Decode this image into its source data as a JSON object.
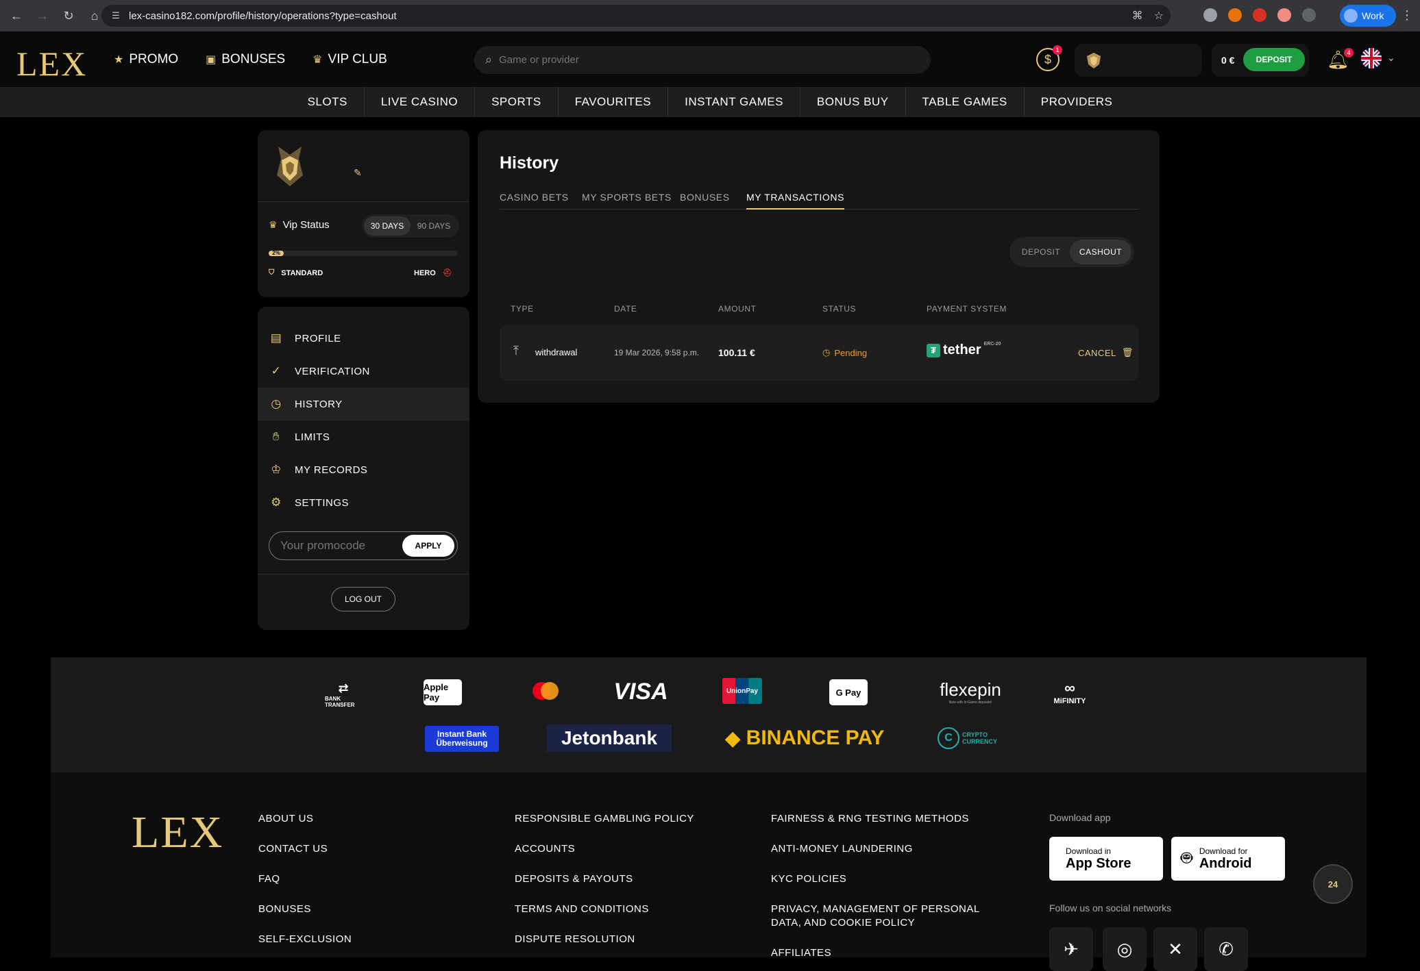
{
  "browser": {
    "url": "lex-casino182.com/profile/history/operations?type=cashout",
    "profile_label": "Work"
  },
  "header": {
    "logo": "LEX",
    "nav": [
      {
        "label": "PROMO",
        "icon": "star-icon"
      },
      {
        "label": "BONUSES",
        "icon": "gift-icon"
      },
      {
        "label": "VIP CLUB",
        "icon": "crown-icon"
      }
    ],
    "search_placeholder": "Game or provider",
    "cash_badge": "1",
    "balance": "0 €",
    "deposit_label": "DEPOSIT",
    "notif_badge": "4"
  },
  "categories": [
    "SLOTS",
    "LIVE CASINO",
    "SPORTS",
    "FAVOURITES",
    "INSTANT GAMES",
    "BONUS BUY",
    "TABLE GAMES",
    "PROVIDERS"
  ],
  "sidebar": {
    "vip_label": "Vip Status",
    "range_options": [
      "30 DAYS",
      "90 DAYS"
    ],
    "progress_label": "2%",
    "progress_value": 0.08,
    "level_from": "STANDARD",
    "level_to": "HERO",
    "menu": [
      {
        "label": "PROFILE",
        "icon": "id-card-icon"
      },
      {
        "label": "VERIFICATION",
        "icon": "verified-badge-icon"
      },
      {
        "label": "HISTORY",
        "icon": "history-clock-icon"
      },
      {
        "label": "LIMITS",
        "icon": "hand-icon"
      },
      {
        "label": "MY RECORDS",
        "icon": "trophy-icon"
      },
      {
        "label": "SETTINGS",
        "icon": "gear-icon"
      }
    ],
    "promo_placeholder": "Your promocode",
    "apply_label": "APPLY",
    "logout_label": "LOG OUT"
  },
  "main": {
    "title": "History",
    "tabs": [
      "CASINO BETS",
      "MY SPORTS BETS",
      "BONUSES",
      "MY TRANSACTIONS"
    ],
    "active_tab": "MY TRANSACTIONS",
    "type_options": [
      "DEPOSIT",
      "CASHOUT"
    ],
    "active_type": "CASHOUT",
    "columns": [
      "TYPE",
      "DATE",
      "AMOUNT",
      "STATUS",
      "PAYMENT SYSTEM"
    ],
    "rows": [
      {
        "type": "withdrawal",
        "date": "19 Mar 2026, 9:58 p.m.",
        "amount": "100.11 €",
        "status": "Pending",
        "payment_system": "tether",
        "payment_tag": "ERC-20",
        "action": "CANCEL"
      }
    ]
  },
  "payments": {
    "row1": [
      "BANK TRANSFER",
      "Apple Pay",
      "Mastercard",
      "VISA",
      "UnionPay",
      "G Pay",
      "flexepin",
      "MiFINITY"
    ],
    "row2": [
      "Instant Bank Überweisung",
      "Jetonbank",
      "BINANCE PAY",
      "CRYPTO CURRENCY"
    ],
    "flexepin_tagline": "Now with In-Game deposits!"
  },
  "footer": {
    "logo": "LEX",
    "col1": [
      "ABOUT US",
      "CONTACT US",
      "FAQ",
      "BONUSES",
      "SELF-EXCLUSION"
    ],
    "col2": [
      "RESPONSIBLE GAMBLING POLICY",
      "ACCOUNTS",
      "DEPOSITS & PAYOUTS",
      "TERMS AND CONDITIONS",
      "DISPUTE RESOLUTION"
    ],
    "col3": [
      "FAIRNESS & RNG TESTING METHODS",
      "ANTI-MONEY LAUNDERING",
      "KYC POLICIES",
      "PRIVACY, MANAGEMENT OF PERSONAL DATA, AND COOKIE POLICY",
      "AFFILIATES"
    ],
    "download_label": "Download app",
    "app_store": {
      "small": "Download in",
      "big": "App Store"
    },
    "android": {
      "small": "Download for",
      "big": "Android"
    },
    "social_label": "Follow us on social networks",
    "socials": [
      "telegram-icon",
      "instagram-icon",
      "x-icon",
      "whatsapp-icon"
    ],
    "support_label": "24"
  }
}
